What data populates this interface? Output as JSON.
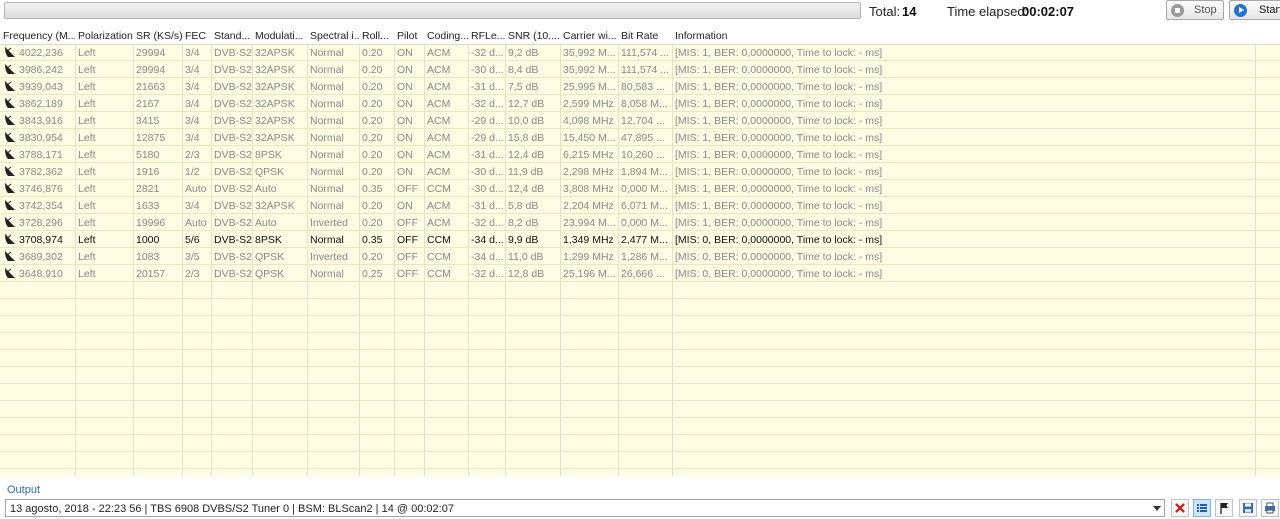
{
  "toolbar": {
    "total_label": "Total:",
    "total_value": "14",
    "elapsed_label": "Time elapsed:",
    "elapsed_value": "00:02:07",
    "stop_label": "Stop",
    "start_label": "Start"
  },
  "table": {
    "columns": [
      "Frequency (M...",
      "Polarization",
      "SR (KS/s)",
      "FEC",
      "Stand...",
      "Modulati...",
      "Spectral i...",
      "Roll...",
      "Pilot",
      "Coding...",
      "RFLe...",
      "SNR (10....",
      "Carrier wi...",
      "Bit Rate",
      "Information"
    ],
    "rows": [
      {
        "frequency": "4022,236",
        "polarization": "Left",
        "sr": "29994",
        "fec": "3/4",
        "standard": "DVB-S2",
        "modulation": "32APSK",
        "spectral": "Normal",
        "rolloff": "0.20",
        "pilot": "ON",
        "coding": "ACM",
        "rflevel": "-32 d...",
        "snr": "9,2 dB",
        "carrier": "35,992 M...",
        "bitrate": "111,574 ...",
        "info": "[MIS: 1, BER: 0,0000000, Time to lock: - ms]"
      },
      {
        "frequency": "3986,242",
        "polarization": "Left",
        "sr": "29994",
        "fec": "3/4",
        "standard": "DVB-S2",
        "modulation": "32APSK",
        "spectral": "Normal",
        "rolloff": "0.20",
        "pilot": "ON",
        "coding": "ACM",
        "rflevel": "-30 d...",
        "snr": "8,4 dB",
        "carrier": "35,992 M...",
        "bitrate": "111,574 ...",
        "info": "[MIS: 1, BER: 0,0000000, Time to lock: - ms]"
      },
      {
        "frequency": "3939,043",
        "polarization": "Left",
        "sr": "21663",
        "fec": "3/4",
        "standard": "DVB-S2",
        "modulation": "32APSK",
        "spectral": "Normal",
        "rolloff": "0.20",
        "pilot": "ON",
        "coding": "ACM",
        "rflevel": "-31 d...",
        "snr": "7,5 dB",
        "carrier": "25,995 M...",
        "bitrate": "80,583 ...",
        "info": "[MIS: 1, BER: 0,0000000, Time to lock: - ms]"
      },
      {
        "frequency": "3862,189",
        "polarization": "Left",
        "sr": "2167",
        "fec": "3/4",
        "standard": "DVB-S2",
        "modulation": "32APSK",
        "spectral": "Normal",
        "rolloff": "0.20",
        "pilot": "ON",
        "coding": "ACM",
        "rflevel": "-32 d...",
        "snr": "12,7 dB",
        "carrier": "2,599 MHz",
        "bitrate": "8,058 M...",
        "info": "[MIS: 1, BER: 0,0000000, Time to lock: - ms]"
      },
      {
        "frequency": "3843,916",
        "polarization": "Left",
        "sr": "3415",
        "fec": "3/4",
        "standard": "DVB-S2",
        "modulation": "32APSK",
        "spectral": "Normal",
        "rolloff": "0.20",
        "pilot": "ON",
        "coding": "ACM",
        "rflevel": "-29 d...",
        "snr": "10,0 dB",
        "carrier": "4,098 MHz",
        "bitrate": "12,704 ...",
        "info": "[MIS: 1, BER: 0,0000000, Time to lock: - ms]"
      },
      {
        "frequency": "3830,954",
        "polarization": "Left",
        "sr": "12875",
        "fec": "3/4",
        "standard": "DVB-S2",
        "modulation": "32APSK",
        "spectral": "Normal",
        "rolloff": "0.20",
        "pilot": "ON",
        "coding": "ACM",
        "rflevel": "-29 d...",
        "snr": "15,8 dB",
        "carrier": "15,450 M...",
        "bitrate": "47,895 ...",
        "info": "[MIS: 1, BER: 0,0000000, Time to lock: - ms]"
      },
      {
        "frequency": "3788,171",
        "polarization": "Left",
        "sr": "5180",
        "fec": "2/3",
        "standard": "DVB-S2",
        "modulation": "8PSK",
        "spectral": "Normal",
        "rolloff": "0.20",
        "pilot": "ON",
        "coding": "ACM",
        "rflevel": "-31 d...",
        "snr": "12,4 dB",
        "carrier": "6,215 MHz",
        "bitrate": "10,260 ...",
        "info": "[MIS: 1, BER: 0,0000000, Time to lock: - ms]"
      },
      {
        "frequency": "3782,362",
        "polarization": "Left",
        "sr": "1916",
        "fec": "1/2",
        "standard": "DVB-S2",
        "modulation": "QPSK",
        "spectral": "Normal",
        "rolloff": "0.20",
        "pilot": "ON",
        "coding": "ACM",
        "rflevel": "-30 d...",
        "snr": "11,9 dB",
        "carrier": "2,298 MHz",
        "bitrate": "1,894 M...",
        "info": "[MIS: 1, BER: 0,0000000, Time to lock: - ms]"
      },
      {
        "frequency": "3746,876",
        "polarization": "Left",
        "sr": "2821",
        "fec": "Auto",
        "standard": "DVB-S2",
        "modulation": "Auto",
        "spectral": "Normal",
        "rolloff": "0.35",
        "pilot": "OFF",
        "coding": "CCM",
        "rflevel": "-30 d...",
        "snr": "12,4 dB",
        "carrier": "3,808 MHz",
        "bitrate": "0,000 M...",
        "info": "[MIS: 1, BER: 0,0000000, Time to lock: - ms]"
      },
      {
        "frequency": "3742,354",
        "polarization": "Left",
        "sr": "1633",
        "fec": "3/4",
        "standard": "DVB-S2",
        "modulation": "32APSK",
        "spectral": "Normal",
        "rolloff": "0.20",
        "pilot": "ON",
        "coding": "ACM",
        "rflevel": "-31 d...",
        "snr": "5,8 dB",
        "carrier": "2,204 MHz",
        "bitrate": "6,071 M...",
        "info": "[MIS: 1, BER: 0,0000000, Time to lock: - ms]"
      },
      {
        "frequency": "3728,296",
        "polarization": "Left",
        "sr": "19996",
        "fec": "Auto",
        "standard": "DVB-S2",
        "modulation": "Auto",
        "spectral": "Inverted",
        "rolloff": "0.20",
        "pilot": "OFF",
        "coding": "ACM",
        "rflevel": "-32 d...",
        "snr": "8,2 dB",
        "carrier": "23,994 M...",
        "bitrate": "0,000 M...",
        "info": "[MIS: 1, BER: 0,0000000, Time to lock: - ms]"
      },
      {
        "frequency": "3708,974",
        "polarization": "Left",
        "sr": "1000",
        "fec": "5/6",
        "standard": "DVB-S2",
        "modulation": "8PSK",
        "spectral": "Normal",
        "rolloff": "0.35",
        "pilot": "OFF",
        "coding": "CCM",
        "rflevel": "-34 d...",
        "snr": "9,9 dB",
        "carrier": "1,349 MHz",
        "bitrate": "2,477 M...",
        "info": "[MIS: 0, BER: 0,0000000, Time to lock: - ms]",
        "active": true
      },
      {
        "frequency": "3689,302",
        "polarization": "Left",
        "sr": "1083",
        "fec": "3/5",
        "standard": "DVB-S2",
        "modulation": "QPSK",
        "spectral": "Inverted",
        "rolloff": "0.20",
        "pilot": "OFF",
        "coding": "CCM",
        "rflevel": "-34 d...",
        "snr": "11,0 dB",
        "carrier": "1,299 MHz",
        "bitrate": "1,286 M...",
        "info": "[MIS: 0, BER: 0,0000000, Time to lock: - ms]"
      },
      {
        "frequency": "3648,910",
        "polarization": "Left",
        "sr": "20157",
        "fec": "2/3",
        "standard": "DVB-S2",
        "modulation": "QPSK",
        "spectral": "Normal",
        "rolloff": "0.25",
        "pilot": "OFF",
        "coding": "CCM",
        "rflevel": "-32 d...",
        "snr": "12,8 dB",
        "carrier": "25,196 M...",
        "bitrate": "26,666 ...",
        "info": "[MIS: 0, BER: 0,0000000, Time to lock: - ms]"
      }
    ]
  },
  "output": {
    "label": "Output",
    "value": "13 agosto, 2018 - 22:23 56 | TBS 6908 DVBS/S2 Tuner 0 | BSM: BLScan2 | 14 @ 00:02:07"
  },
  "output_buttons": [
    "clear-icon",
    "list-icon",
    "flag-icon",
    "save-icon",
    "print-icon"
  ],
  "colors": {
    "grid_bg": "#fdfde3",
    "clear": "#d02020",
    "accent": "#1f74d6"
  }
}
